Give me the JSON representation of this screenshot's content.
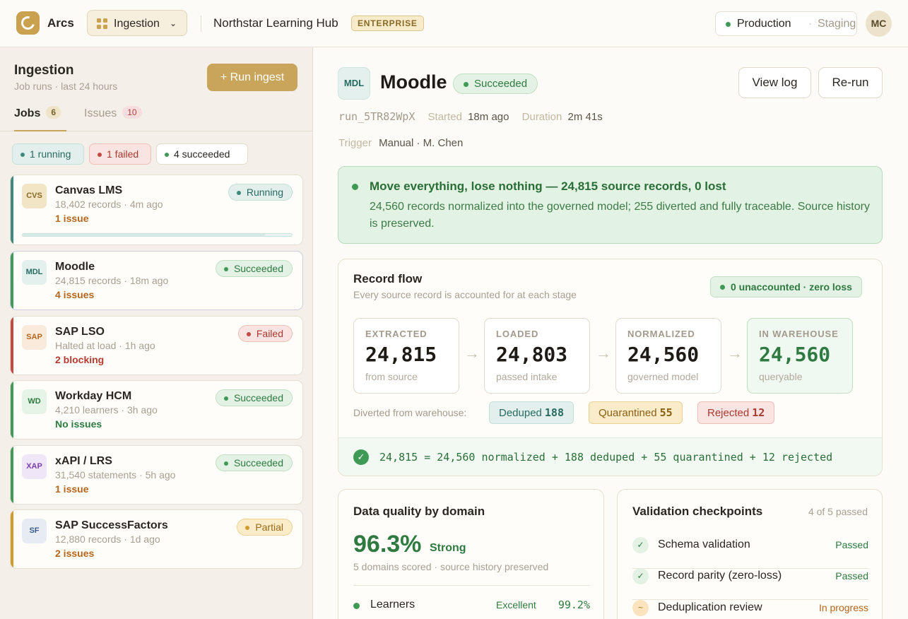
{
  "app": {
    "name": "Arcs",
    "module": "Ingestion",
    "org": "Northstar Learning Hub",
    "plan": "ENTERPRISE",
    "env_active": "Production",
    "env_sep": "·",
    "env_other": "Staging",
    "user_initials": "MC"
  },
  "sidebar": {
    "title": "Ingestion",
    "subtitle": "Job runs · last 24 hours",
    "run_button": "+  Run ingest",
    "tabs": [
      {
        "label": "Jobs",
        "count": "6"
      },
      {
        "label": "Issues",
        "count": "10"
      }
    ],
    "filters": {
      "running": "1 running",
      "failed": "1 failed",
      "succeeded": "4 succeeded"
    },
    "jobs": [
      {
        "code": "CVS",
        "name": "Canvas LMS",
        "meta": "18,402 records · 4m ago",
        "issues": "1 issue",
        "status": "Running",
        "progress": 0.9,
        "color": "#3e8a7a",
        "iconbg": "#f1e5c6",
        "iconfg": "#8a6a23"
      },
      {
        "code": "MDL",
        "name": "Moodle",
        "meta": "24,815 records · 18m ago",
        "issues": "4 issues",
        "status": "Succeeded",
        "color": "#3f9a55",
        "iconbg": "#e3f0ee",
        "iconfg": "#276b60"
      },
      {
        "code": "SAP",
        "name": "SAP LSO",
        "meta": "Halted at load · 1h ago",
        "issues": "2 blocking",
        "status": "Failed",
        "color": "#c24a40",
        "iconbg": "#faeadc",
        "iconfg": "#b5661a"
      },
      {
        "code": "WD",
        "name": "Workday HCM",
        "meta": "4,210 learners · 3h ago",
        "issues": "No issues",
        "status": "Succeeded",
        "color": "#3f9a55",
        "iconbg": "#e6f3e7",
        "iconfg": "#2e7a40"
      },
      {
        "code": "XAP",
        "name": "xAPI / LRS",
        "meta": "31,540 statements · 5h ago",
        "issues": "1 issue",
        "status": "Succeeded",
        "color": "#3f9a55",
        "iconbg": "#efe6f7",
        "iconfg": "#7a3fb0"
      },
      {
        "code": "SF",
        "name": "SAP SuccessFactors",
        "meta": "12,880 records · 1d ago",
        "issues": "2 issues",
        "status": "Partial",
        "color": "#d19a2c",
        "iconbg": "#e7ecf4",
        "iconfg": "#3a5a8a"
      }
    ]
  },
  "main": {
    "icon_code": "MDL",
    "title": "Moodle",
    "status": "Succeeded",
    "buttons": {
      "view_log": "View log",
      "rerun": "Re-run"
    },
    "run_id": "run_5TR82WpX",
    "started_label": "Started",
    "started_value": "18m ago",
    "duration_label": "Duration",
    "duration_value": "2m 41s",
    "trigger_label": "Trigger",
    "trigger_value": "Manual · M. Chen",
    "banner": {
      "heading": "Move everything, lose nothing — 24,815 source records, 0 lost",
      "body": "24,560 records normalized into the governed model; 255 diverted and fully traceable. Source history is preserved."
    },
    "flow": {
      "title": "Record flow",
      "subtitle": "Every source record is accounted for at each stage",
      "unaccounted": "0 unaccounted · zero loss",
      "stages": [
        {
          "label": "EXTRACTED",
          "value": "24,815",
          "desc": "from source"
        },
        {
          "label": "LOADED",
          "value": "24,803",
          "desc": "passed intake"
        },
        {
          "label": "NORMALIZED",
          "value": "24,560",
          "desc": "governed model"
        },
        {
          "label": "IN WAREHOUSE",
          "value": "24,560",
          "desc": "queryable"
        }
      ],
      "arrow": "→",
      "diverted_label": "Diverted from warehouse:",
      "diverted": [
        {
          "label": "Deduped",
          "value": "188"
        },
        {
          "label": "Quarantined",
          "value": "55"
        },
        {
          "label": "Rejected",
          "value": "12"
        }
      ],
      "check": "✓",
      "equation": "24,815 = 24,560 normalized + 188 deduped + 55 quarantined + 12 rejected"
    },
    "quality": {
      "title": "Data quality by domain",
      "score": "96.3%",
      "rating": "Strong",
      "subtitle": "5 domains scored · source history preserved",
      "rows": [
        {
          "name": "Learners",
          "rating": "Excellent",
          "pct": "99.2%"
        }
      ]
    },
    "validation": {
      "title": "Validation checkpoints",
      "count": "4 of 5 passed",
      "rows": [
        {
          "icon": "✓",
          "name": "Schema validation",
          "status": "Passed",
          "state": "ok"
        },
        {
          "icon": "✓",
          "name": "Record parity (zero-loss)",
          "status": "Passed",
          "state": "ok"
        },
        {
          "icon": "~",
          "name": "Deduplication review",
          "status": "In progress",
          "state": "pr"
        }
      ]
    }
  }
}
